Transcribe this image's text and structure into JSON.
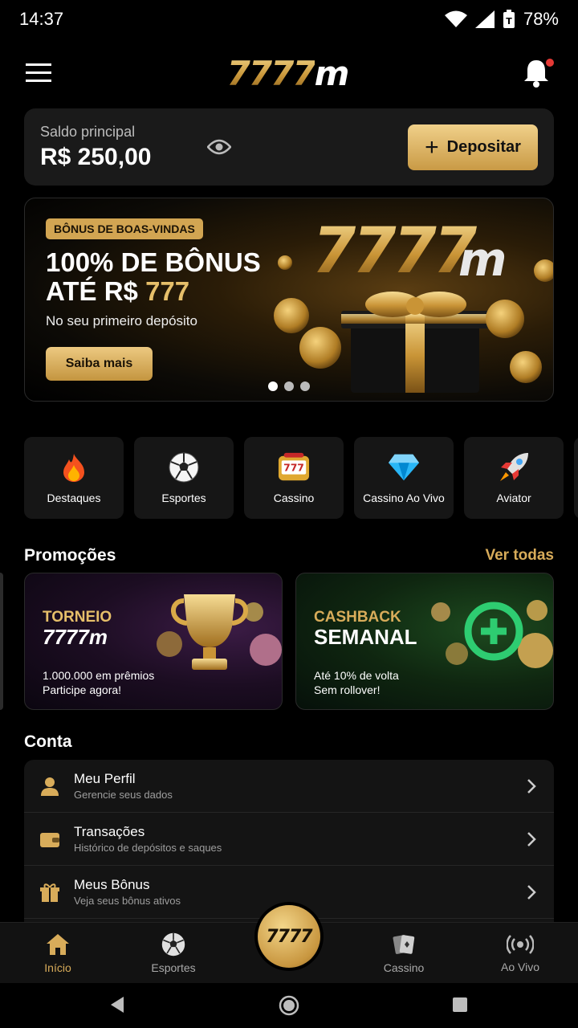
{
  "status": {
    "time": "14:37",
    "battery": "78%"
  },
  "header": {
    "logo_num": "7777",
    "logo_m": "m",
    "menu_icon": "hamburger-icon",
    "bell_icon": "bell-icon"
  },
  "balance": {
    "label": "Saldo principal",
    "value": "R$ 250,00",
    "deposit_label": "Depositar"
  },
  "banner": {
    "badge": "BÔNUS DE BOAS-VINDAS",
    "line1": "100% DE BÔNUS",
    "line2_prefix": "ATÉ R$ ",
    "line2_amount": "777",
    "subtitle": "No seu primeiro depósito",
    "cta": "Saiba mais",
    "art_logo_num": "7777",
    "art_logo_m": "m",
    "slides": 3,
    "active_slide": 1
  },
  "categories": [
    {
      "label": "Destaques",
      "icon": "fire-icon"
    },
    {
      "label": "Esportes",
      "icon": "soccer-ball-icon"
    },
    {
      "label": "Cassino",
      "icon": "slot-machine-icon"
    },
    {
      "label": "Cassino Ao Vivo",
      "icon": "diamond-icon"
    },
    {
      "label": "Aviator",
      "icon": "rocket-icon"
    }
  ],
  "promotions": {
    "title": "Promoções",
    "see_all": "Ver todas",
    "items": [
      {
        "title1": "TORNEIO",
        "title2": "7777m",
        "desc1": "1.000.000 em prêmios",
        "desc2": "Participe agora!",
        "title_color": "#e6bf6a"
      },
      {
        "title1": "CASHBACK",
        "title2": "SEMANAL",
        "desc1": "Até 10% de volta",
        "desc2": "Sem rollover!",
        "title_color": "#d8ac5a"
      }
    ]
  },
  "account": {
    "title": "Conta",
    "items": [
      {
        "title": "Meu Perfil",
        "desc": "Gerencie seus dados",
        "icon": "user-icon"
      },
      {
        "title": "Transações",
        "desc": "Histórico de depósitos e saques",
        "icon": "wallet-icon"
      },
      {
        "title": "Meus Bônus",
        "desc": "Veja seus bônus ativos",
        "icon": "gift-icon"
      }
    ]
  },
  "bottom_nav": {
    "items": [
      {
        "label": "Início",
        "icon": "home-icon",
        "active": true
      },
      {
        "label": "Esportes",
        "icon": "soccer-ball-icon",
        "active": false
      },
      {
        "label": "Cassino",
        "icon": "cards-icon",
        "active": false
      },
      {
        "label": "Ao Vivo",
        "icon": "live-icon",
        "active": false
      }
    ],
    "center_label": "7777"
  },
  "colors": {
    "accent_gold": "#d8ac5a",
    "bg": "#000000",
    "card": "#1a1a1a",
    "notification": "#e53935"
  }
}
